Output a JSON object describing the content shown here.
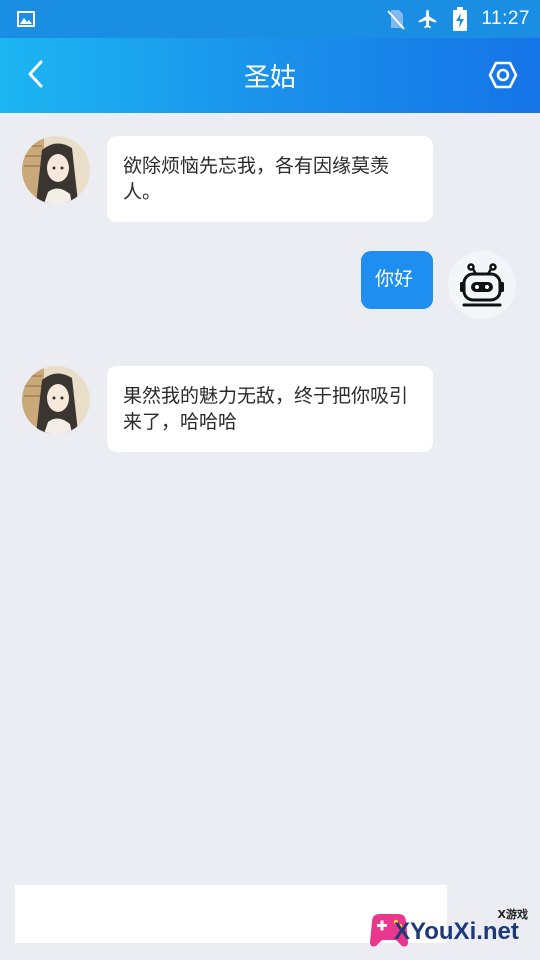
{
  "status_bar": {
    "time": "11:27",
    "icons": [
      "image-icon",
      "no-sim-icon",
      "airplane-icon",
      "battery-charging-icon"
    ]
  },
  "header": {
    "title": "圣姑",
    "back_icon": "chevron-left-icon",
    "settings_icon": "settings-hexagon-icon"
  },
  "messages": [
    {
      "side": "incoming",
      "avatar": "character-avatar",
      "text": "欲除烦恼先忘我，各有因缘莫羡人。"
    },
    {
      "side": "outgoing",
      "avatar": "robot-avatar",
      "text": "你好"
    },
    {
      "side": "incoming",
      "avatar": "character-avatar",
      "text": "果然我的魅力无敌，终于把你吸引来了，哈哈哈"
    }
  ],
  "input": {
    "value": "",
    "placeholder": ""
  },
  "watermark": {
    "small": "X游戏",
    "main": "XYouXi.net"
  },
  "colors": {
    "status_bar": "#1A8EE3",
    "header_start": "#1CB6F2",
    "header_end": "#1574E8",
    "outgoing_bubble": "#1E8FF0",
    "background": "#EBEDF2"
  }
}
